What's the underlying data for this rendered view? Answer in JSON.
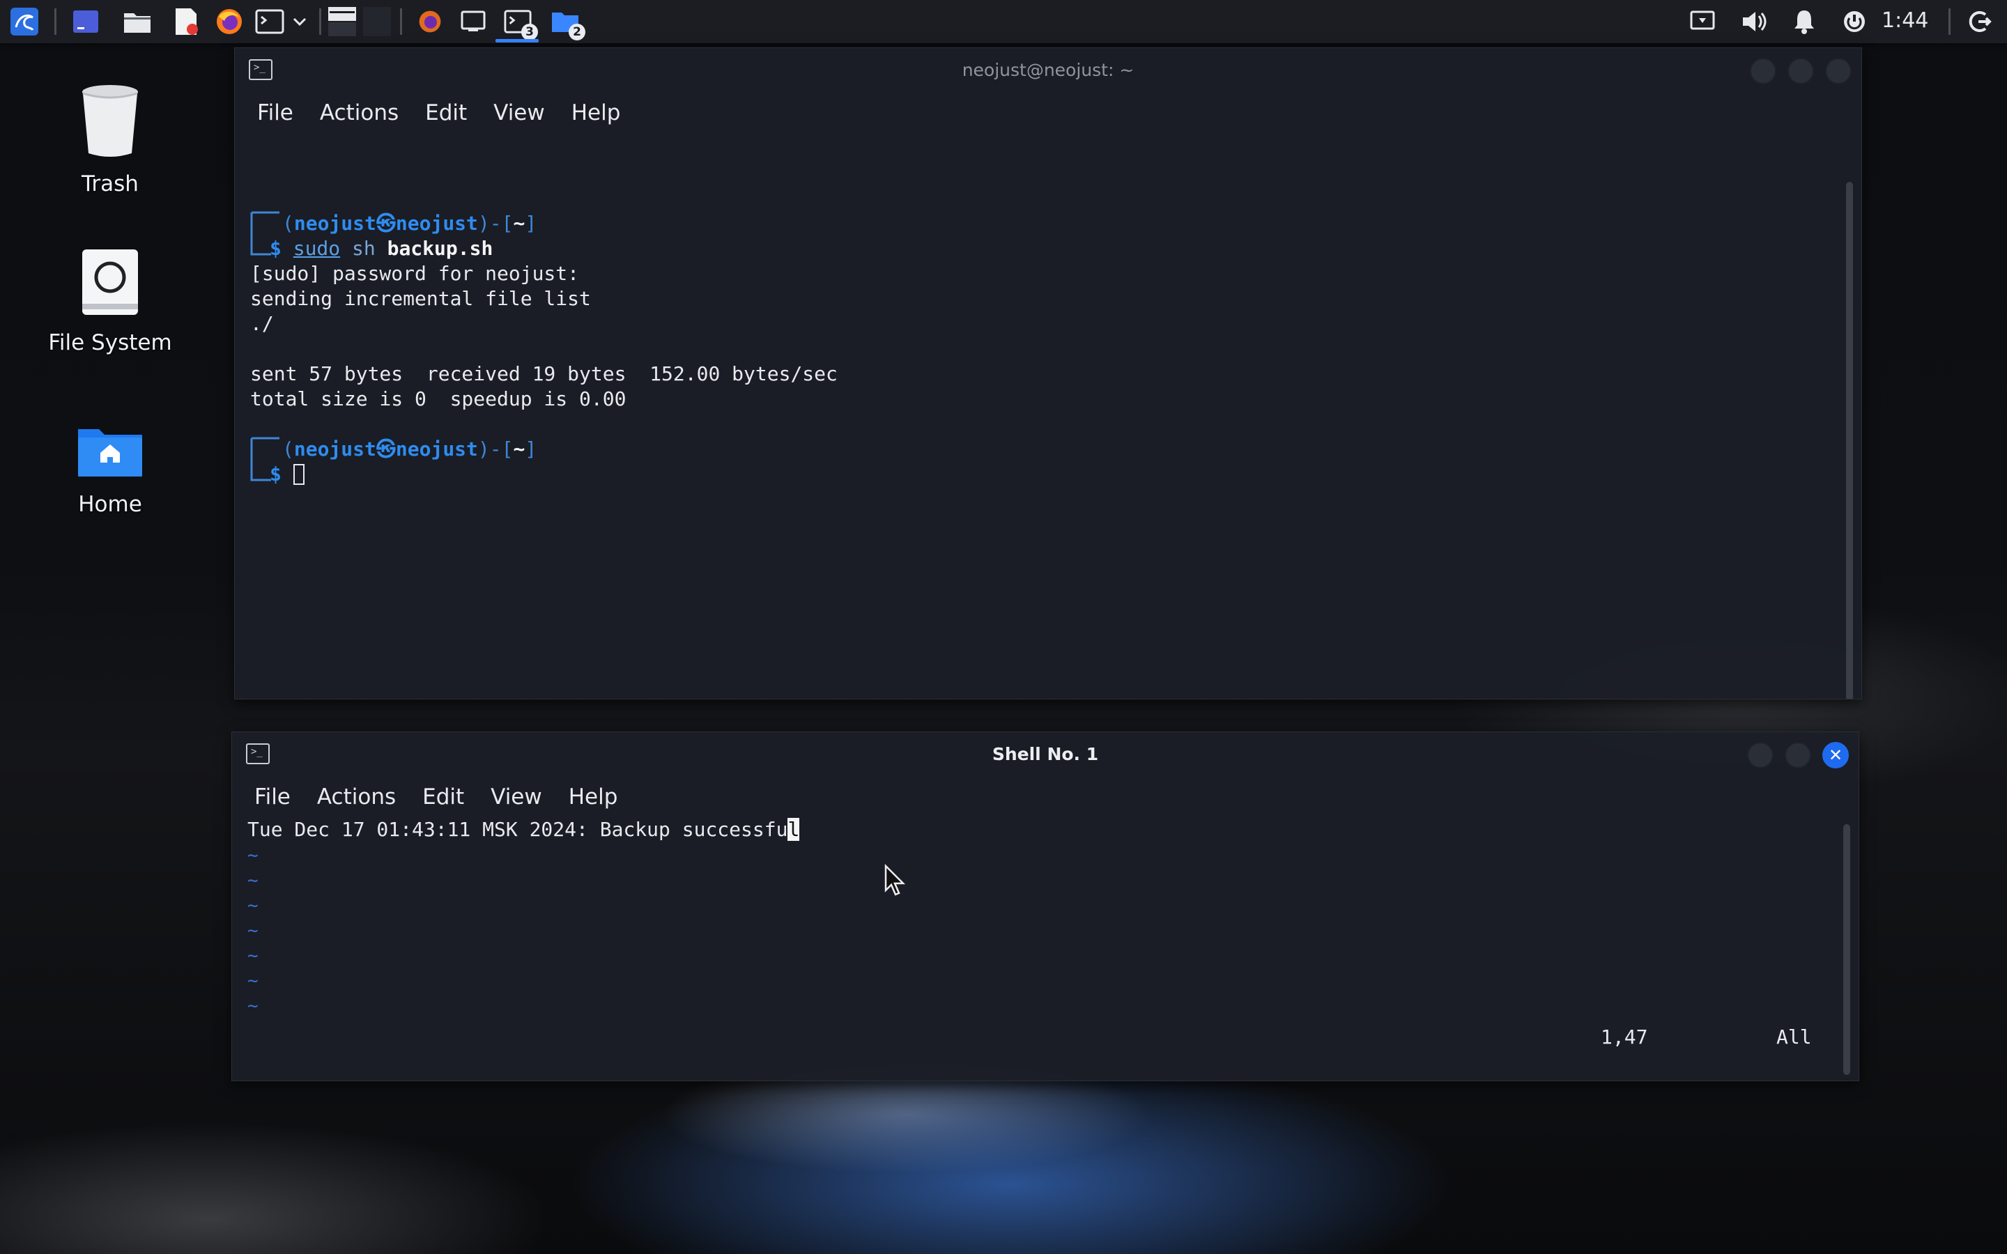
{
  "panel": {
    "clock": "1:44",
    "icons": [
      "kali-menu-icon",
      "workspace-icon",
      "file-manager-icon",
      "text-editor-icon",
      "firefox-icon",
      "terminal-icon",
      "chevron-down-icon",
      "window-list-icon",
      "firefox-task-icon",
      "window-task-icon",
      "terminal-task-icon",
      "folder-task-icon",
      "display-icon",
      "volume-icon",
      "bell-icon",
      "power-icon",
      "logout-icon"
    ],
    "terminal_task_count": "3",
    "folder_task_count": "2"
  },
  "desktop": {
    "icons": [
      {
        "label": "Trash",
        "icon": "trash-icon"
      },
      {
        "label": "File System",
        "icon": "drive-icon"
      },
      {
        "label": "Home",
        "icon": "home-folder-icon"
      }
    ]
  },
  "window_top": {
    "title": "neojust@neojust: ~",
    "menu": [
      "File",
      "Actions",
      "Edit",
      "View",
      "Help"
    ],
    "prompt_user": "neojust",
    "prompt_at": "㉿",
    "prompt_host": "neojust",
    "prompt_dir": "~",
    "cmd_sudo": "sudo",
    "cmd_sh": "sh",
    "cmd_file": "backup.sh",
    "output": [
      "[sudo] password for neojust:",
      "sending incremental file list",
      "./",
      "",
      "sent 57 bytes  received 19 bytes  152.00 bytes/sec",
      "total size is 0  speedup is 0.00"
    ]
  },
  "window_bottom": {
    "title": "Shell No. 1",
    "menu": [
      "File",
      "Actions",
      "Edit",
      "View",
      "Help"
    ],
    "line_text": "Tue Dec 17 01:43:11 MSK 2024: Backup successfu",
    "line_cursor_char": "l",
    "tilde": "~",
    "ruler_pos": "1,47",
    "ruler_all": "All"
  },
  "colors": {
    "panel_bg": "#1b1d23",
    "accent": "#1e6bf0",
    "prompt_blue": "#2f8cf0"
  }
}
